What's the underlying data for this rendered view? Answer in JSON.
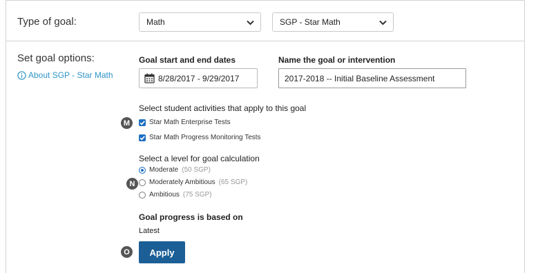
{
  "goal_type": {
    "label": "Type of goal:",
    "subject_select": "Math",
    "assessment_select": "SGP - Star Math"
  },
  "options": {
    "label": "Set goal options:",
    "about_link": "About SGP - Star Math",
    "dates_header": "Goal start and end dates",
    "dates_value": "8/28/2017 - 9/29/2017",
    "name_header": "Name the goal or intervention",
    "name_value": "2017-2018 -- Initial Baseline Assessment"
  },
  "activities": {
    "marker": "M",
    "title": "Select student activities that apply to this goal",
    "items": [
      {
        "label": "Star Math Enterprise Tests",
        "checked": true
      },
      {
        "label": "Star Math Progress Monitoring Tests",
        "checked": true
      }
    ]
  },
  "levels": {
    "marker": "N",
    "title": "Select a level for goal calculation",
    "items": [
      {
        "label": "Moderate",
        "note": "(50 SGP)",
        "selected": true
      },
      {
        "label": "Moderately Ambitious",
        "note": "(65 SGP)",
        "selected": false
      },
      {
        "label": "Ambitious",
        "note": "(75 SGP)",
        "selected": false
      }
    ]
  },
  "progress": {
    "title": "Goal progress is based on",
    "value": "Latest"
  },
  "apply": {
    "marker": "O",
    "label": "Apply"
  },
  "colors": {
    "link": "#2e95c7",
    "accent": "#1e6fc2",
    "apply_button": "#1c5f97",
    "marker": "#555555"
  }
}
